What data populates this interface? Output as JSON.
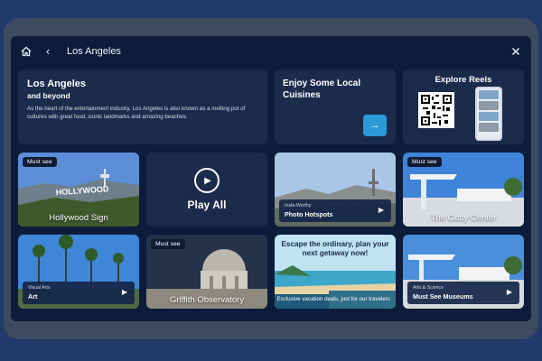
{
  "header": {
    "title": "Los Angeles"
  },
  "intro": {
    "title": "Los Angeles",
    "subtitle": "and beyond",
    "description": "As the heart of the entertainment industry, Los Angeles is also known as a melting pot of cultures with great food, iconic landmarks and amazing beaches."
  },
  "cuisine": {
    "title": "Enjoy Some Local Cuisines"
  },
  "reels": {
    "title": "Explore Reels"
  },
  "tiles": {
    "hollywood": {
      "badge": "Must see",
      "caption": "Hollywood Sign"
    },
    "playall": {
      "label": "Play All"
    },
    "hotspots": {
      "sub": "Insta-Worthy",
      "main": "Photo Hotspots"
    },
    "getty": {
      "badge": "Must see",
      "caption": "The Getty Center"
    },
    "art": {
      "sub": "Visual Arts",
      "main": "Art"
    },
    "griffith": {
      "badge": "Must see",
      "caption": "Griffith Observatory"
    },
    "promo": {
      "headline": "Escape the ordinary, plan your next getaway now!",
      "sub": "Exclusive vacation deals, just for our travelers"
    },
    "museums": {
      "sub": "Arts & Science",
      "main": "Must See Museums"
    }
  },
  "colors": {
    "background": "#1f3a6b",
    "screen": "#0c1c3a",
    "card": "#1b2b4b",
    "accent": "#2b9ad8"
  },
  "icons": {
    "home": "home-icon",
    "back": "chevron-left-icon",
    "close": "close-icon",
    "arrow": "arrow-right-icon",
    "play": "play-icon"
  }
}
